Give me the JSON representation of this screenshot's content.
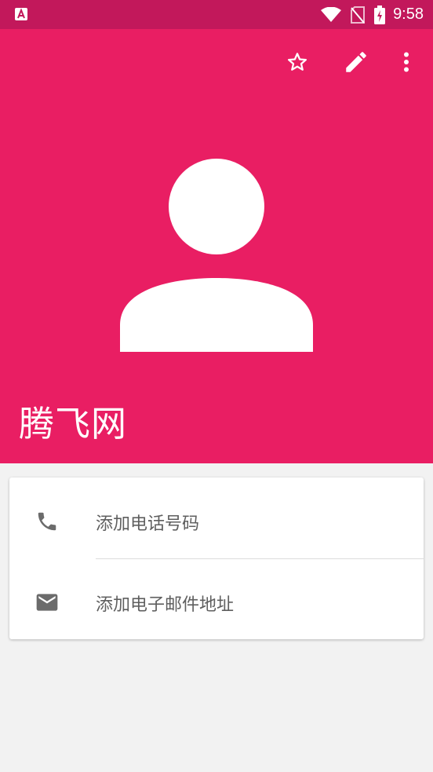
{
  "status_bar": {
    "time": "9:58",
    "icons": [
      "notification-a-icon",
      "wifi-icon",
      "no-sim-icon",
      "battery-charging-icon"
    ]
  },
  "header": {
    "background_color": "#e91e63",
    "actions": [
      "star-icon",
      "edit-icon",
      "more-vert-icon"
    ],
    "contact_name": "腾飞网"
  },
  "details": {
    "phone": {
      "icon": "phone-icon",
      "label": "添加电话号码"
    },
    "email": {
      "icon": "email-icon",
      "label": "添加电子邮件地址"
    }
  },
  "colors": {
    "status_bar": "#c2185b",
    "header": "#e91e63",
    "icon_gray": "#6b6b6b"
  }
}
